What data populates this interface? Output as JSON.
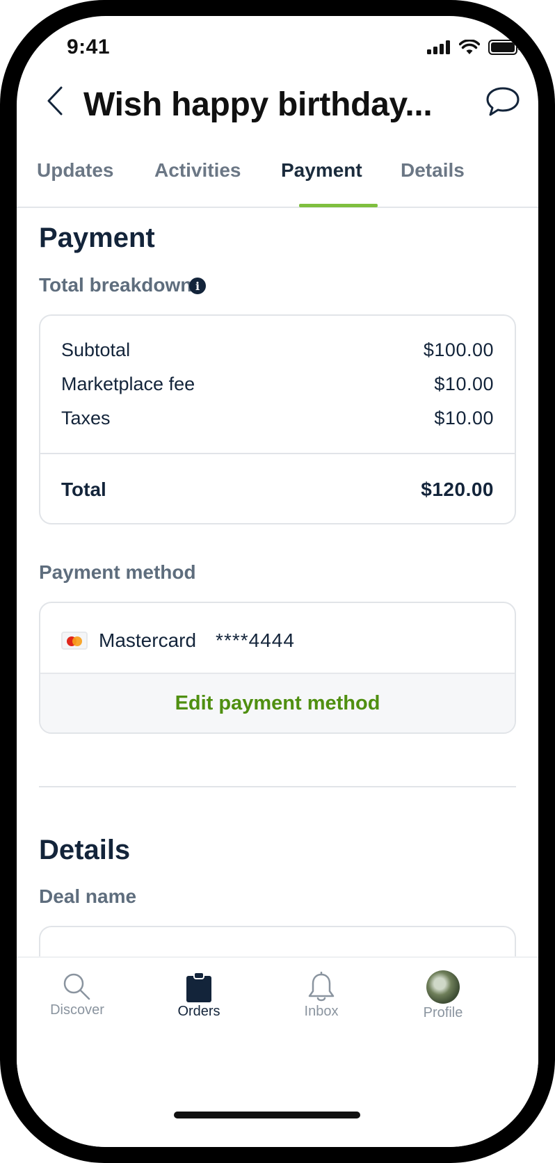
{
  "status_bar": {
    "time": "9:41"
  },
  "header": {
    "title": "Wish happy birthday..."
  },
  "tabs": [
    {
      "label": "Updates",
      "active": false
    },
    {
      "label": "Activities",
      "active": false
    },
    {
      "label": "Payment",
      "active": true
    },
    {
      "label": "Details",
      "active": false
    }
  ],
  "payment": {
    "heading": "Payment",
    "breakdown_label": "Total breakdown",
    "info_icon": "info-icon",
    "lines": [
      {
        "label": "Subtotal",
        "value": "$100.00"
      },
      {
        "label": "Marketplace fee",
        "value": "$10.00"
      },
      {
        "label": "Taxes",
        "value": "$10.00"
      }
    ],
    "total": {
      "label": "Total",
      "value": "$120.00"
    },
    "method_label": "Payment method",
    "method": {
      "brand": "Mastercard",
      "number": "****4444"
    },
    "edit_label": "Edit payment method"
  },
  "details": {
    "heading": "Details",
    "deal_name_label": "Deal name"
  },
  "bottom_nav": [
    {
      "label": "Discover",
      "icon": "search-icon",
      "active": false
    },
    {
      "label": "Orders",
      "icon": "clipboard-icon",
      "active": true
    },
    {
      "label": "Inbox",
      "icon": "bell-icon",
      "active": false
    },
    {
      "label": "Profile",
      "icon": "avatar",
      "active": false
    }
  ],
  "colors": {
    "accent": "#7fbf3f",
    "link_green": "#4f8f10",
    "primary_text": "#13243a",
    "muted_text": "#5e6d7d"
  }
}
